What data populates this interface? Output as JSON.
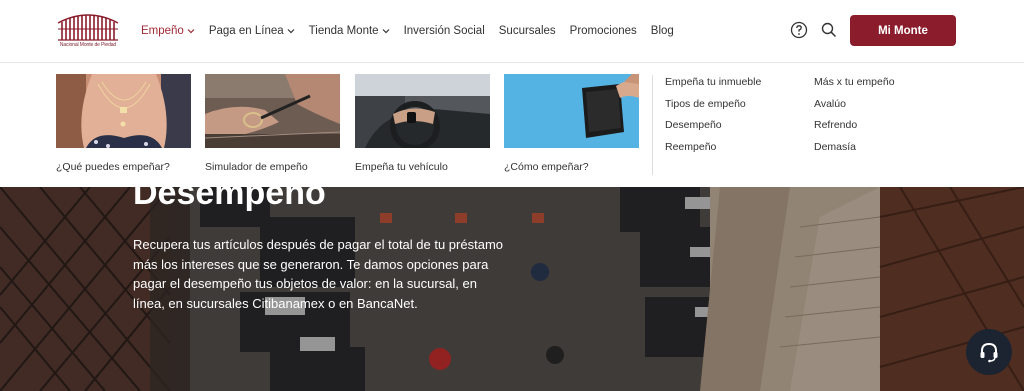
{
  "brand": {
    "name": "Nacional Monte de Piedad",
    "logo_color": "#8b1c2b"
  },
  "nav": {
    "items": [
      {
        "label": "Empeño",
        "has_dropdown": true,
        "active": true
      },
      {
        "label": "Paga en Línea",
        "has_dropdown": true
      },
      {
        "label": "Tienda Monte",
        "has_dropdown": true
      },
      {
        "label": "Inversión Social",
        "has_dropdown": false
      },
      {
        "label": "Sucursales",
        "has_dropdown": false
      },
      {
        "label": "Promociones",
        "has_dropdown": false
      },
      {
        "label": "Blog",
        "has_dropdown": false
      }
    ],
    "cta_label": "Mi Monte",
    "accent": "#8b1c2b",
    "icons": [
      "help-icon",
      "search-icon"
    ]
  },
  "mega_menu": {
    "cards": [
      {
        "label": "¿Qué puedes empeñar?",
        "image": "necklace"
      },
      {
        "label": "Simulador de empeño",
        "image": "jeweler"
      },
      {
        "label": "Empeña tu vehículo",
        "image": "steering-wheel"
      },
      {
        "label": "¿Cómo empeñar?",
        "image": "wallet"
      }
    ],
    "links_col1": [
      "Empeña tu inmueble",
      "Tipos de empeño",
      "Desempeño",
      "Reempeño"
    ],
    "links_col2": [
      "Más x tu empeño",
      "Avalúo",
      "Refrendo",
      "Demasía"
    ]
  },
  "hero": {
    "title": "Desempeño",
    "text": "Recupera tus artículos después de pagar el total de tu préstamo más los intereses que se generaron. Te damos opciones para pagar el desempeño tus objetos de valor: en la sucursal, en línea, en sucursales Citibanamex o en BancaNet."
  },
  "chat": {
    "icon": "headset-icon"
  }
}
